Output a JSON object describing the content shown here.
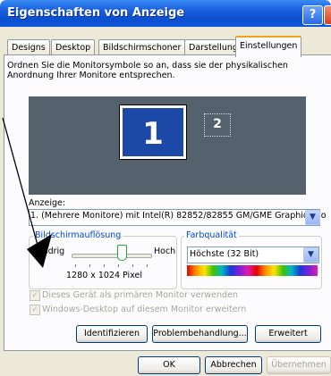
{
  "window": {
    "title": "Eigenschaften von Anzeige",
    "help": "?",
    "close": "✕"
  },
  "tabs": [
    {
      "label": "Designs"
    },
    {
      "label": "Desktop"
    },
    {
      "label": "Bildschirmschoner"
    },
    {
      "label": "Darstellung"
    },
    {
      "label": "Einstellungen",
      "active": true
    }
  ],
  "instructions": "Ordnen Sie die Monitorsymbole so an, dass sie der physikalischen Anordnung Ihrer Monitore entsprechen.",
  "monitors": [
    {
      "number": "1"
    },
    {
      "number": "2"
    }
  ],
  "display": {
    "label": "Anzeige:",
    "value": "1. (Mehrere Monitore) mit Intel(R) 82852/82855 GM/GME Graphics Co"
  },
  "resolution": {
    "legend": "Bildschirmauflösung",
    "low": "Niedrig",
    "high": "Hoch",
    "value": "1280 x 1024 Pixel",
    "slider_level": 0.64
  },
  "color_quality": {
    "legend": "Farbqualität",
    "value": "Höchste (32 Bit)"
  },
  "checkboxes": [
    {
      "label": "Dieses Gerät als primären Monitor verwenden",
      "checked": true,
      "disabled": true
    },
    {
      "label": "Windows-Desktop auf diesem Monitor erweitern",
      "checked": true,
      "disabled": true
    }
  ],
  "actions": {
    "identify": "Identifizieren",
    "troubleshoot": "Problembehandlung...",
    "advanced": "Erweitert"
  },
  "footer": {
    "ok": "OK",
    "cancel": "Abbrechen",
    "apply": "Übernehmen"
  },
  "colors": {
    "titlebar": "#0a4fd0",
    "dialog": "#ece9d8",
    "panel": "#fcfcfe",
    "preview": "#56616e",
    "monitor_active": "#1c48a8",
    "group_label": "#0046d5"
  }
}
